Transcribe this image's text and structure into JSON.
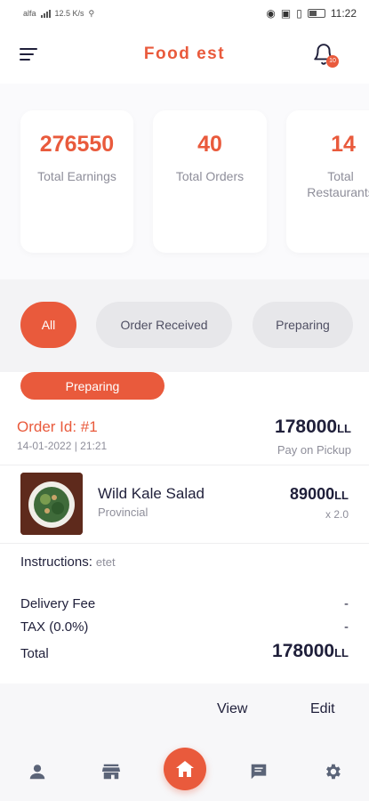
{
  "status_bar": {
    "carrier": "alfa",
    "speed": "12.5 K/s",
    "battery": "50",
    "time": "11:22"
  },
  "header": {
    "title": "Food est",
    "notification_count": "10"
  },
  "stats": [
    {
      "value": "276550",
      "label": "Total Earnings"
    },
    {
      "value": "40",
      "label": "Total Orders"
    },
    {
      "value": "14",
      "label": "Total Restaurants"
    }
  ],
  "filters": {
    "all": "All",
    "order_received": "Order Received",
    "preparing": "Preparing"
  },
  "order": {
    "status": "Preparing",
    "id": "Order Id: #1",
    "date": "14-01-2022 | 21:21",
    "total": "178000",
    "currency": "LL",
    "payment": "Pay on Pickup",
    "item": {
      "name": "Wild Kale Salad",
      "category": "Provincial",
      "price": "89000",
      "quantity": "x 2.0"
    },
    "instructions_label": "Instructions:",
    "instructions_value": "etet",
    "delivery_fee_label": "Delivery Fee",
    "delivery_fee_value": "-",
    "tax_label": "TAX (0.0%)",
    "tax_value": "-",
    "total_label": "Total"
  },
  "actions": {
    "view": "View",
    "edit": "Edit"
  },
  "nav": [
    "profile-icon",
    "store-icon",
    "home-icon",
    "chat-icon",
    "settings-icon"
  ],
  "colors": {
    "accent": "#e95a3c",
    "text": "#1f1f3a",
    "muted": "#8e8e9a"
  }
}
